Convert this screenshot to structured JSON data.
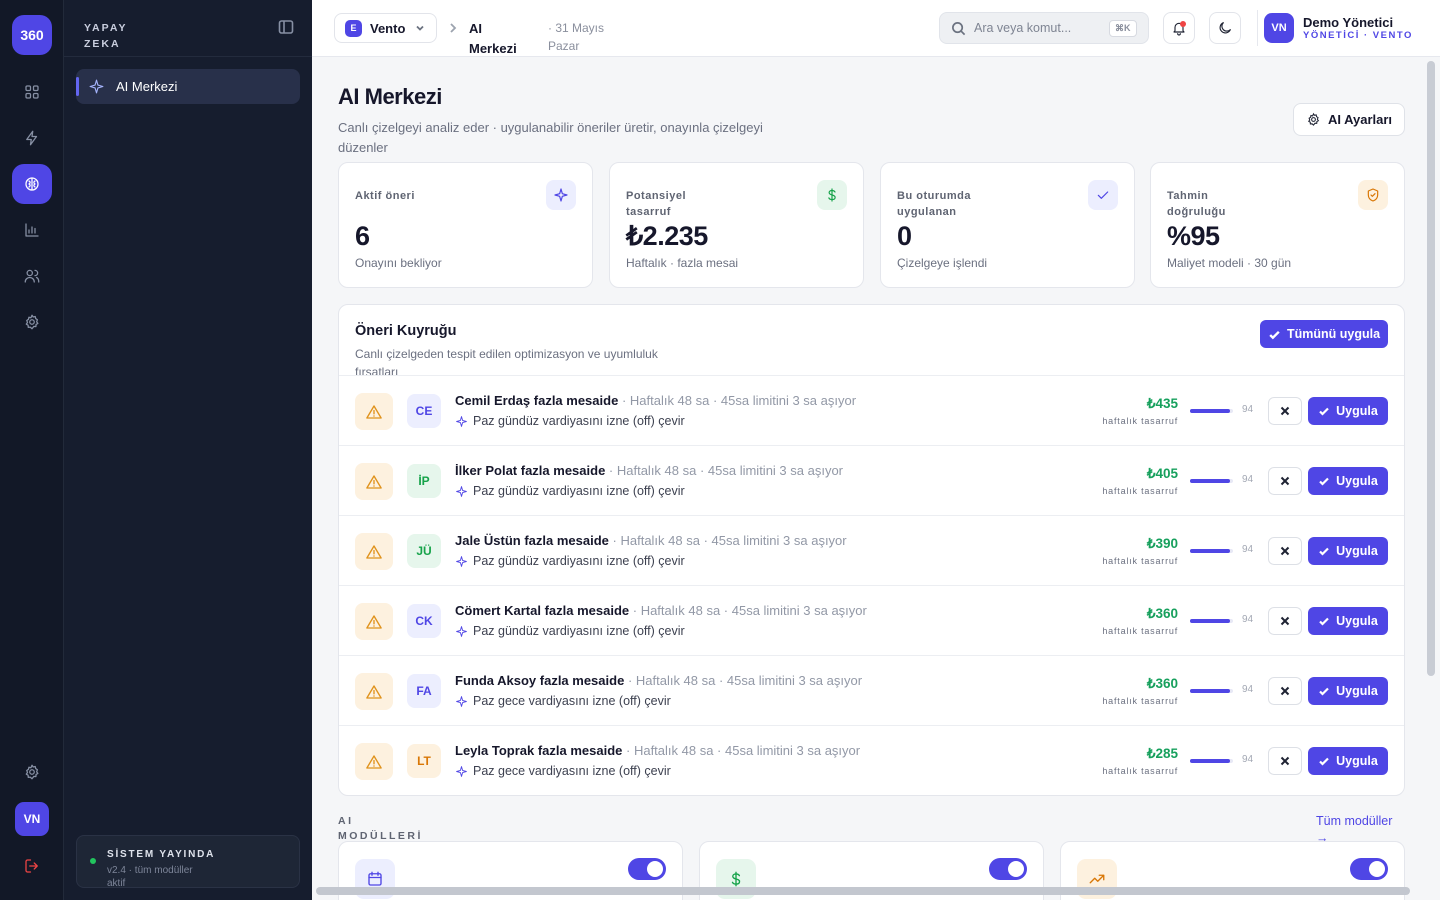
{
  "brand": {
    "logo": "360"
  },
  "rail": {
    "icons": [
      "grid-icon",
      "bolt-icon",
      "brain-icon",
      "bar-chart-icon",
      "users-icon",
      "gear-icon"
    ],
    "avatar": "VN",
    "bottom_icons": [
      "gear-icon",
      "logout-icon"
    ]
  },
  "panel": {
    "title": "YAPAY ZEKA",
    "nav": [
      {
        "label": "AI Merkezi",
        "icon": "sparkle-icon"
      }
    ],
    "status": {
      "title": "SİSTEM YAYINDA",
      "subtitle": "v2.4 · tüm modüller aktif"
    }
  },
  "topbar": {
    "workspace": {
      "badge": "E",
      "name": "Vento"
    },
    "breadcrumb": "AI Merkezi",
    "date": "· 31 Mayıs Pazar",
    "search": {
      "placeholder": "Ara veya komut...",
      "shortcut": "⌘K"
    },
    "user": {
      "initials": "VN",
      "name": "Demo Yönetici",
      "role": "YÖNETİCİ · VENTO"
    }
  },
  "page": {
    "title": "AI Merkezi",
    "subtitle": "Canlı çizelgeyi analiz eder · uygulanabilir öneriler üretir, onayınla çizelgeyi düzenler",
    "settings_button": "AI Ayarları"
  },
  "stats": [
    {
      "label": "Aktif öneri",
      "value": "6",
      "hint": "Onayını bekliyor",
      "icon": "sparkle-icon",
      "color": "#4f46e5",
      "bg": "#eceefe"
    },
    {
      "label": "Potansiyel tasarruf",
      "value": "₺2.235",
      "hint": "Haftalık · fazla mesai",
      "icon": "dollar-icon",
      "color": "#16a34a",
      "bg": "#e6f6ec"
    },
    {
      "label": "Bu oturumda uygulanan",
      "value": "0",
      "hint": "Çizelgeye işlendi",
      "icon": "check-icon",
      "color": "#4f46e5",
      "bg": "#eceefe"
    },
    {
      "label": "Tahmin doğruluğu",
      "value": "%95",
      "hint": "Maliyet modeli · 30 gün",
      "icon": "shield-icon",
      "color": "#d97706",
      "bg": "#fdf1df"
    }
  ],
  "queue": {
    "title": "Öneri Kuyruğu",
    "subtitle": "Canlı çizelgeden tespit edilen optimizasyon ve uyumluluk fırsatları",
    "apply_all": "Tümünü uygula",
    "reject_icon": "close-icon",
    "apply_label": "Uygula",
    "items": [
      {
        "initials": "CE",
        "ini_color": "#4f46e5",
        "ini_bg": "#eceefe",
        "title": "Cemil Erdaş fazla mesaide",
        "detail": "· Haftalık 48 sa · 45sa limitini 3 sa aşıyor",
        "action": "Paz gündüz vardiyasını izne (off) çevir",
        "amount": "₺435",
        "amount_label": "haftalık tasarruf",
        "score": "94"
      },
      {
        "initials": "İP",
        "ini_color": "#16a34a",
        "ini_bg": "#e6f6ec",
        "title": "İlker Polat fazla mesaide",
        "detail": "· Haftalık 48 sa · 45sa limitini 3 sa aşıyor",
        "action": "Paz gündüz vardiyasını izne (off) çevir",
        "amount": "₺405",
        "amount_label": "haftalık tasarruf",
        "score": "94"
      },
      {
        "initials": "JÜ",
        "ini_color": "#16a34a",
        "ini_bg": "#e6f6ec",
        "title": "Jale Üstün fazla mesaide",
        "detail": "· Haftalık 48 sa · 45sa limitini 3 sa aşıyor",
        "action": "Paz gündüz vardiyasını izne (off) çevir",
        "amount": "₺390",
        "amount_label": "haftalık tasarruf",
        "score": "94"
      },
      {
        "initials": "CK",
        "ini_color": "#4f46e5",
        "ini_bg": "#eceefe",
        "title": "Cömert Kartal fazla mesaide",
        "detail": "· Haftalık 48 sa · 45sa limitini 3 sa aşıyor",
        "action": "Paz gündüz vardiyasını izne (off) çevir",
        "amount": "₺360",
        "amount_label": "haftalık tasarruf",
        "score": "94"
      },
      {
        "initials": "FA",
        "ini_color": "#4f46e5",
        "ini_bg": "#eceefe",
        "title": "Funda Aksoy fazla mesaide",
        "detail": "· Haftalık 48 sa · 45sa limitini 3 sa aşıyor",
        "action": "Paz gece vardiyasını izne (off) çevir",
        "amount": "₺360",
        "amount_label": "haftalık tasarruf",
        "score": "94"
      },
      {
        "initials": "LT",
        "ini_color": "#d97706",
        "ini_bg": "#fdf1df",
        "title": "Leyla Toprak fazla mesaide",
        "detail": "· Haftalık 48 sa · 45sa limitini 3 sa aşıyor",
        "action": "Paz gece vardiyasını izne (off) çevir",
        "amount": "₺285",
        "amount_label": "haftalık tasarruf",
        "score": "94"
      }
    ]
  },
  "modules": {
    "title": "AI MODÜLLERİ",
    "link": "Tüm modüller →",
    "cards": [
      {
        "icon": "calendar-icon",
        "color": "#4f46e5",
        "bg": "#eceefe",
        "enabled": true
      },
      {
        "icon": "dollar-icon",
        "color": "#16a34a",
        "bg": "#e6f6ec",
        "enabled": true
      },
      {
        "icon": "trend-icon",
        "color": "#d97706",
        "bg": "#fdf1df",
        "enabled": true
      }
    ]
  }
}
